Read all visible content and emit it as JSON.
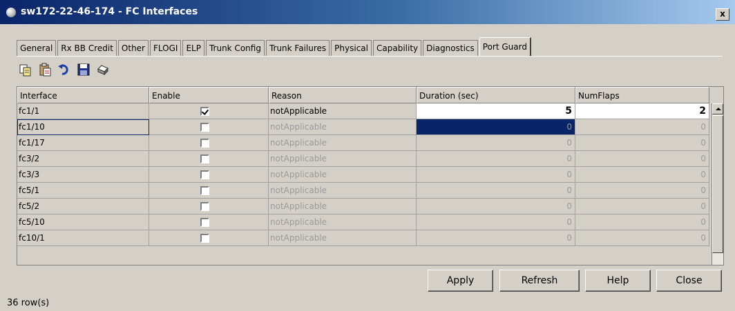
{
  "window": {
    "title": "sw172-22-46-174 - FC Interfaces",
    "close_label": "x"
  },
  "tabs": [
    {
      "label": "General"
    },
    {
      "label": "Rx BB Credit"
    },
    {
      "label": "Other"
    },
    {
      "label": "FLOGI"
    },
    {
      "label": "ELP"
    },
    {
      "label": "Trunk Config"
    },
    {
      "label": "Trunk Failures"
    },
    {
      "label": "Physical"
    },
    {
      "label": "Capability"
    },
    {
      "label": "Diagnostics"
    },
    {
      "label": "Port Guard"
    }
  ],
  "active_tab": "Port Guard",
  "toolbar": [
    {
      "icon": "copy-icon"
    },
    {
      "icon": "paste-icon"
    },
    {
      "icon": "undo-icon"
    },
    {
      "icon": "save-icon"
    },
    {
      "icon": "print-icon"
    }
  ],
  "table": {
    "columns": [
      "Interface",
      "Enable",
      "Reason",
      "Duration (sec)",
      "NumFlaps"
    ],
    "rows": [
      {
        "interface": "fc1/1",
        "enable": true,
        "reason": "notApplicable",
        "duration": "5",
        "numflaps": "2"
      },
      {
        "interface": "fc1/10",
        "enable": false,
        "reason": "notApplicable",
        "duration": "0",
        "numflaps": "0"
      },
      {
        "interface": "fc1/17",
        "enable": false,
        "reason": "notApplicable",
        "duration": "0",
        "numflaps": "0"
      },
      {
        "interface": "fc3/2",
        "enable": false,
        "reason": "notApplicable",
        "duration": "0",
        "numflaps": "0"
      },
      {
        "interface": "fc3/3",
        "enable": false,
        "reason": "notApplicable",
        "duration": "0",
        "numflaps": "0"
      },
      {
        "interface": "fc5/1",
        "enable": false,
        "reason": "notApplicable",
        "duration": "0",
        "numflaps": "0"
      },
      {
        "interface": "fc5/2",
        "enable": false,
        "reason": "notApplicable",
        "duration": "0",
        "numflaps": "0"
      },
      {
        "interface": "fc5/10",
        "enable": false,
        "reason": "notApplicable",
        "duration": "0",
        "numflaps": "0"
      },
      {
        "interface": "fc10/1",
        "enable": false,
        "reason": "notApplicable",
        "duration": "0",
        "numflaps": "0"
      }
    ]
  },
  "buttons": {
    "apply": "Apply",
    "refresh": "Refresh",
    "help": "Help",
    "close": "Close"
  },
  "status": {
    "row_count": "36 row(s)"
  },
  "colors": {
    "title_gradient_start": "#0a246a",
    "title_gradient_end": "#a6caf0",
    "selection": "#0a246a",
    "window_bg": "#d4d0c8"
  }
}
